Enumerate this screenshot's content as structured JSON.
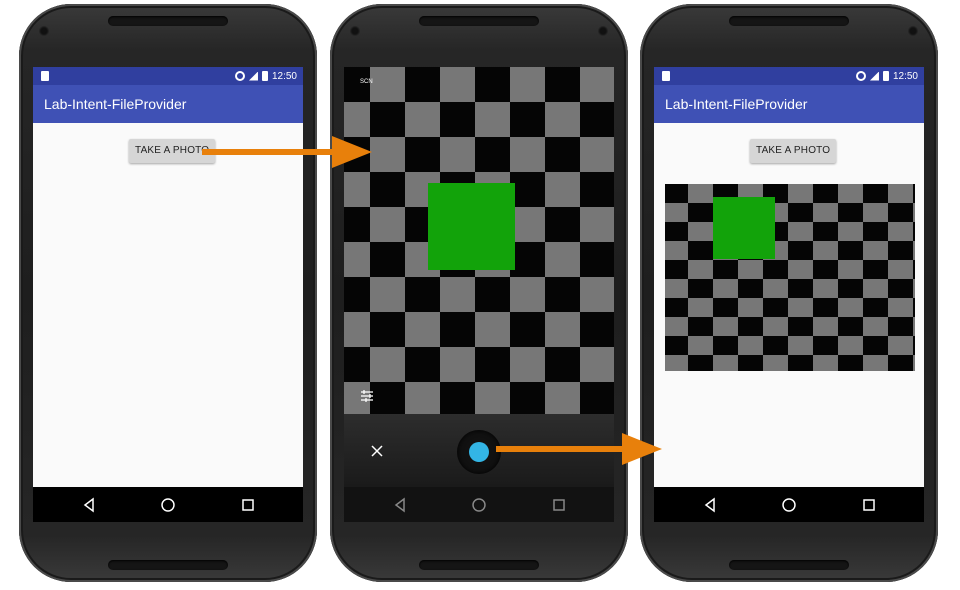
{
  "app": {
    "title": "Lab-Intent-FileProvider"
  },
  "status": {
    "time": "12:50"
  },
  "screen1": {
    "button_label": "TAKE A PHOTO"
  },
  "screen2": {
    "scene_label": "SCN"
  },
  "screen3": {
    "button_label": "TAKE A PHOTO"
  },
  "icons": {
    "status": [
      "sd-card-icon",
      "sync-icon",
      "signal-icon",
      "battery-icon"
    ],
    "nav": [
      "back-icon",
      "home-icon",
      "recents-icon"
    ],
    "camera": [
      "close-icon",
      "shutter-icon",
      "tune-icon"
    ]
  },
  "colors": {
    "statusbar": "#303F9F",
    "appbar": "#3F51B5",
    "shutter": "#33b5e5",
    "arrow": "#e8800b",
    "green_square": "#12a30a"
  }
}
